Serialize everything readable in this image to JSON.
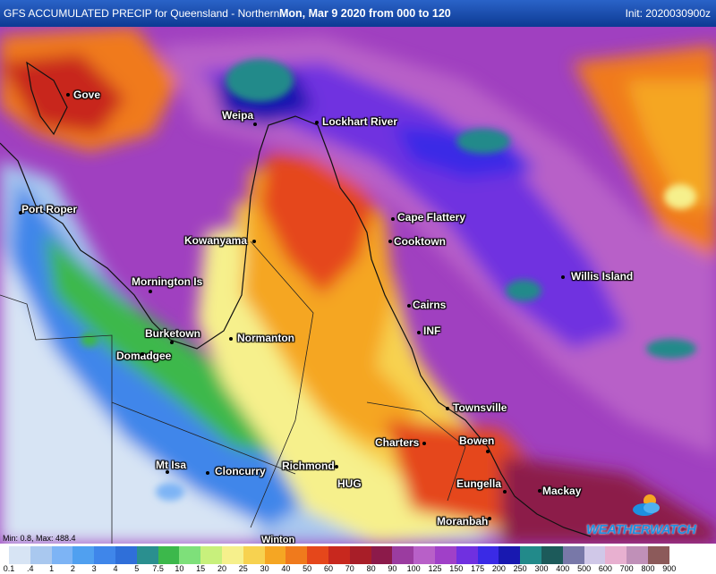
{
  "header": {
    "left": "GFS ACCUMULATED PRECIP for Queensland - Northern",
    "center": "Mon, Mar 9 2020 from 000 to 120",
    "right": "Init: 2020030900z"
  },
  "places": [
    {
      "name": "Gove"
    },
    {
      "name": "Weipa"
    },
    {
      "name": "Lockhart River"
    },
    {
      "name": "Port Roper"
    },
    {
      "name": "Cape Flattery"
    },
    {
      "name": "Kowanyama"
    },
    {
      "name": "Cooktown"
    },
    {
      "name": "Willis Island"
    },
    {
      "name": "Mornington Is"
    },
    {
      "name": "Cairns"
    },
    {
      "name": "INF"
    },
    {
      "name": "Burketown"
    },
    {
      "name": "Normanton"
    },
    {
      "name": "Domadgee"
    },
    {
      "name": "Townsville"
    },
    {
      "name": "Charters"
    },
    {
      "name": "Bowen"
    },
    {
      "name": "Mt Isa"
    },
    {
      "name": "Cloncurry"
    },
    {
      "name": "Richmond"
    },
    {
      "name": "HUG"
    },
    {
      "name": "Eungella"
    },
    {
      "name": "Mackay"
    },
    {
      "name": "Moranbah"
    },
    {
      "name": "Winton"
    }
  ],
  "stats": "Min: 0.8, Max: 488.4",
  "brand": "WEATHERWATCH",
  "legend": {
    "labels": [
      "0.1",
      ".4",
      "1",
      "2",
      "3",
      "4",
      "5",
      "7.5",
      "10",
      "15",
      "20",
      "25",
      "30",
      "40",
      "50",
      "60",
      "70",
      "80",
      "90",
      "100",
      "125",
      "150",
      "175",
      "200",
      "250",
      "300",
      "400",
      "500",
      "600",
      "700",
      "800",
      "900"
    ],
    "colors": [
      "#ffffff",
      "#d7e4f4",
      "#a9c8ef",
      "#7db4f5",
      "#50a0f0",
      "#3f86ea",
      "#2f6fd9",
      "#2a8f8f",
      "#3cb84b",
      "#7ee07a",
      "#c8f07c",
      "#f6f08c",
      "#f7d250",
      "#f5a623",
      "#f07a1c",
      "#e5471b",
      "#c8281e",
      "#a81e28",
      "#8c1a4a",
      "#9b3ca0",
      "#b860c8",
      "#a040c8",
      "#7030e0",
      "#3a2ae6",
      "#1818b0",
      "#228a8a",
      "#1c5a5a",
      "#7878a8",
      "#d0c8e8",
      "#e8b0d0",
      "#c090b8",
      "#8c5a5a"
    ]
  }
}
